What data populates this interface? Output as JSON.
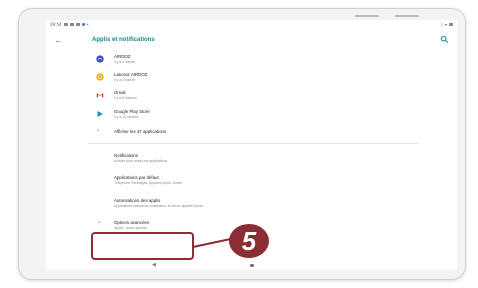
{
  "status": {
    "time": "09:54"
  },
  "app_bar": {
    "title": "Applis et notifications"
  },
  "recent_apps": [
    {
      "title": "AIRDOZ",
      "subtitle": "Il y a 0 minute",
      "icon": "airdoz-icon"
    },
    {
      "title": "Lanceur AIRDOZ",
      "subtitle": "Il y a 0 minute",
      "icon": "launcher-icon"
    },
    {
      "title": "Gmail",
      "subtitle": "Il y a 6 minutes",
      "icon": "gmail-icon"
    },
    {
      "title": "Google Play Store",
      "subtitle": "Il y a 14 minutes",
      "icon": "play-store-icon"
    }
  ],
  "see_all": {
    "label": "Afficher les 47 applications"
  },
  "settings": [
    {
      "title": "Notifications",
      "subtitle": "Activée pour toutes les applications"
    },
    {
      "title": "Applications par défaut",
      "subtitle": "Téléphone, Messages, Appareil photo, Gmail"
    },
    {
      "title": "Autorisations des applis",
      "subtitle": "Applications utilisant la localisation, le micro, appareil photo"
    }
  ],
  "advanced": {
    "title": "Options avancées",
    "subtitle": "Applis : accès spécial"
  },
  "callout": {
    "number": "5"
  },
  "colors": {
    "accent": "#1a8a85",
    "callout": "#8a2d34"
  }
}
